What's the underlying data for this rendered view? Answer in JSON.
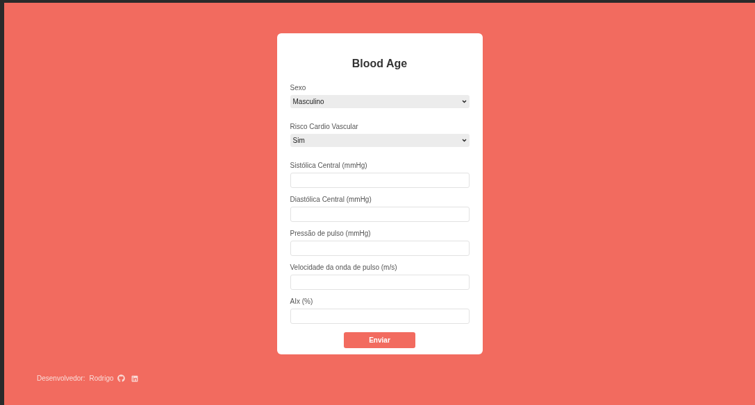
{
  "form": {
    "title": "Blood Age",
    "fields": [
      {
        "kind": "select",
        "label": "Sexo",
        "value": "Masculino"
      },
      {
        "kind": "select",
        "label": "Risco Cardio Vascular",
        "value": "Sim"
      },
      {
        "kind": "text",
        "label": "Sistólica Central (mmHg)"
      },
      {
        "kind": "text",
        "label": "Diastólica Central (mmHg)"
      },
      {
        "kind": "text",
        "label": "Pressão de pulso (mmHg)"
      },
      {
        "kind": "text",
        "label": "Velocidade da onda de pulso (m/s)"
      },
      {
        "kind": "text",
        "label": "AIx (%)"
      }
    ],
    "submit": "Enviar"
  },
  "footer": {
    "label": "Desenvolvedor:",
    "author": "Rodrigo"
  }
}
